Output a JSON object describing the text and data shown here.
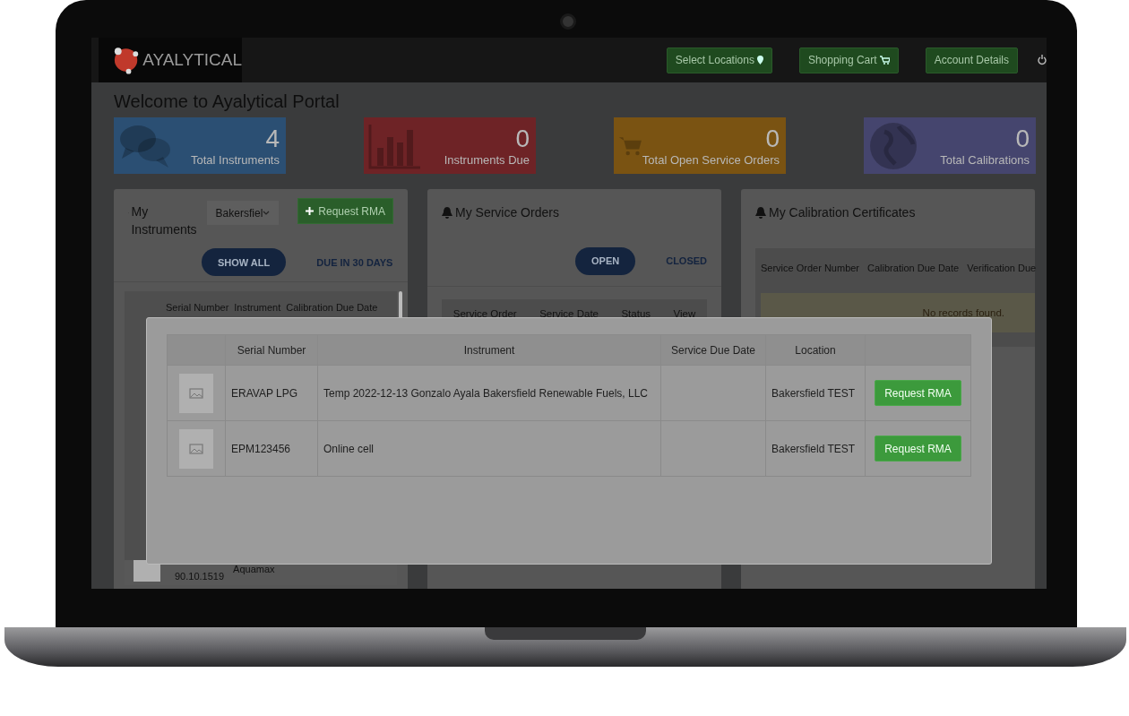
{
  "navbar": {
    "logo": "AYALYTICAL",
    "buttons": [
      {
        "label": "Select Locations",
        "kind": "location"
      },
      {
        "label": "Shopping Cart",
        "kind": "cart"
      },
      {
        "label": "Account Details",
        "kind": "plain"
      }
    ]
  },
  "page_title": "Welcome to Ayalytical Portal",
  "stats": [
    {
      "value": "4",
      "label": "Total Instruments",
      "color": "#2b4f73",
      "kind": "comments"
    },
    {
      "value": "0",
      "label": "Instruments Due",
      "color": "#6e2326",
      "kind": "chart"
    },
    {
      "value": "0",
      "label": "Total Open Service Orders",
      "color": "#7a5312",
      "kind": "cart"
    },
    {
      "value": "0",
      "label": "Total Calibrations",
      "color": "#45456e",
      "kind": "globe"
    }
  ],
  "instruments": {
    "title": "My Instruments",
    "location": "Bakersfiel",
    "button": "Request RMA",
    "filters": [
      {
        "label": "SHOW ALL",
        "selected": true
      },
      {
        "label": "DUE IN 30 DAYS",
        "selected": false
      }
    ],
    "columns": [
      "Serial Number",
      "Instrument",
      "Calibration Due Date"
    ],
    "rows": [
      {
        "serial": "90.10.1519",
        "instrument": "Aquamax"
      }
    ]
  },
  "service_orders": {
    "title": "My Service Orders",
    "filters": [
      {
        "label": "OPEN",
        "selected": true
      },
      {
        "label": "CLOSED",
        "selected": false
      }
    ],
    "columns": [
      "Service Order",
      "Service Date",
      "Status",
      "View"
    ]
  },
  "certificates": {
    "title": "My Calibration Certificates",
    "columns": [
      "Service Order Number",
      "Calibration Due Date",
      "Verification Due"
    ],
    "empty": "No records found."
  },
  "modal": {
    "columns": [
      "Serial Number",
      "Instrument",
      "Service Due Date",
      "Location"
    ],
    "rows": [
      {
        "serial": "ERAVAP LPG",
        "instrument": "Temp 2022-12-13 Gonzalo Ayala Bakersfield Renewable Fuels, LLC",
        "location": "Bakersfield TEST",
        "action": "Request RMA"
      },
      {
        "serial": "EPM123456",
        "instrument": "Online cell",
        "location": "Bakersfield TEST",
        "action": "Request RMA"
      }
    ]
  }
}
